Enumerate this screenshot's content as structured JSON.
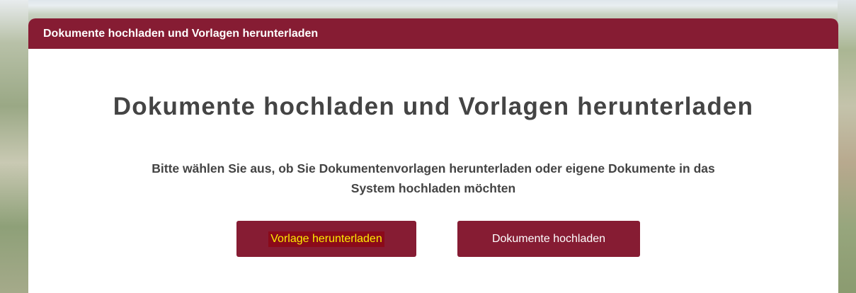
{
  "panel": {
    "header_title": "Dokumente hochladen und Vorlagen herunterladen",
    "main_title": "Dokumente hochladen und Vorlagen herunterladen",
    "description": "Bitte wählen Sie aus, ob Sie Dokumentenvorlagen herunterladen oder eigene Dokumente in das System hochladen möchten"
  },
  "buttons": {
    "download_label": "Vorlage herunterladen",
    "upload_label": "Dokumente hochladen"
  },
  "colors": {
    "brand": "#861c33",
    "highlight_text": "#ffee00",
    "text": "#444444"
  }
}
